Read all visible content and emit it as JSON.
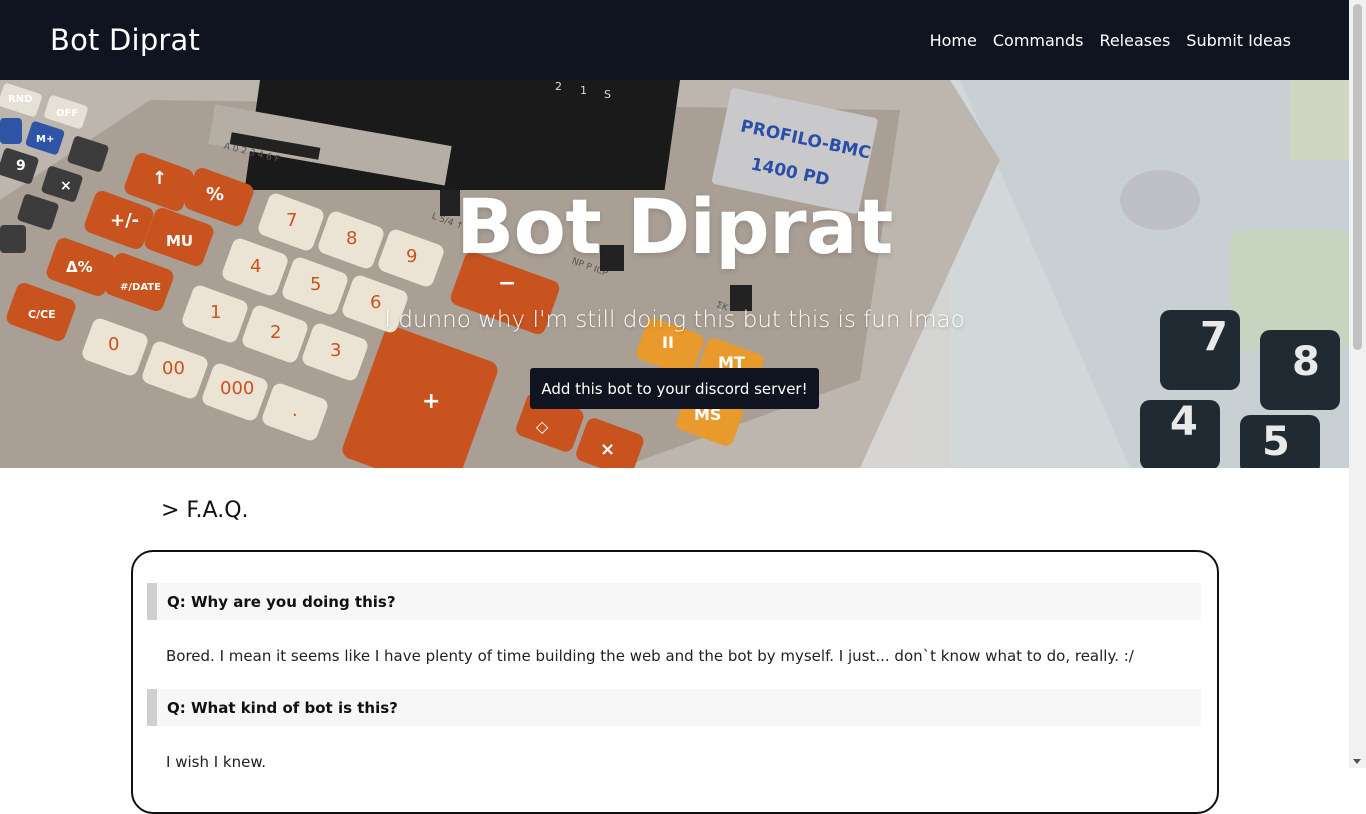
{
  "navbar": {
    "brand": "Bot Diprat",
    "links": [
      "Home",
      "Commands",
      "Releases",
      "Submit Ideas"
    ]
  },
  "hero": {
    "title": "Bot Diprat",
    "subtitle": "I dunno why I'm still doing this but this is fun lmao",
    "button": "Add this bot to your discord server!",
    "background_image": "vintage-calculator-photo",
    "calculator": {
      "display": "PROFILO-BMC",
      "model": "1400 PD",
      "keys": [
        "RND",
        "OFF",
        "M+",
        "9",
        "×",
        "%",
        "↑",
        "MU",
        "Δ%",
        "+/-",
        "#/DATE",
        "C/CE",
        "7",
        "8",
        "9",
        "4",
        "5",
        "6",
        "1",
        "2",
        "3",
        "0",
        "00",
        "000",
        ".",
        "+",
        "−",
        "II",
        "MT",
        "MS",
        "◇",
        "×"
      ],
      "switch_labels": [
        "A 0 2 3 4 6 F",
        "L 5/4 ↑",
        "NP P ICP",
        "ΣK"
      ],
      "right_keys": [
        "7",
        "8",
        "4",
        "5"
      ]
    }
  },
  "faq": {
    "heading": "> F.A.Q.",
    "items": [
      {
        "q": "Q: Why are you doing this?",
        "a": "Bored. I mean it seems like I have plenty of time building the web and the bot by myself. I just... don`t know what to do, really. :/"
      },
      {
        "q": "Q: What kind of bot is this?",
        "a": "I wish I knew."
      }
    ]
  },
  "colors": {
    "navbar": "#0f1420",
    "button": "#0f1420",
    "orange_key": "#c8531f",
    "cream_key": "#ebe4d4"
  }
}
